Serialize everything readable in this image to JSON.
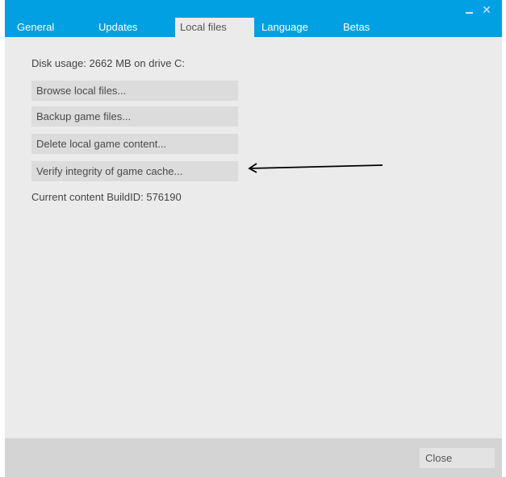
{
  "window": {
    "controls": {
      "minimize_icon": "minimize-icon",
      "close_glyph": "✕"
    }
  },
  "tabs": [
    {
      "label": "General",
      "active": false
    },
    {
      "label": "Updates",
      "active": false
    },
    {
      "label": "Local files",
      "active": true
    },
    {
      "label": "Language",
      "active": false
    },
    {
      "label": "Betas",
      "active": false
    }
  ],
  "local_files": {
    "disk_usage": "Disk usage: 2662 MB on drive C:",
    "buttons": {
      "browse": "Browse local files...",
      "backup": "Backup game files...",
      "delete": "Delete local game content...",
      "verify": "Verify integrity of game cache..."
    },
    "build_id": "Current content BuildID: 576190"
  },
  "footer": {
    "close_label": "Close"
  },
  "colors": {
    "accent": "#00a0e3",
    "panel": "#ebebeb",
    "button": "#dcdcdc",
    "footer": "#d4d4d4"
  }
}
